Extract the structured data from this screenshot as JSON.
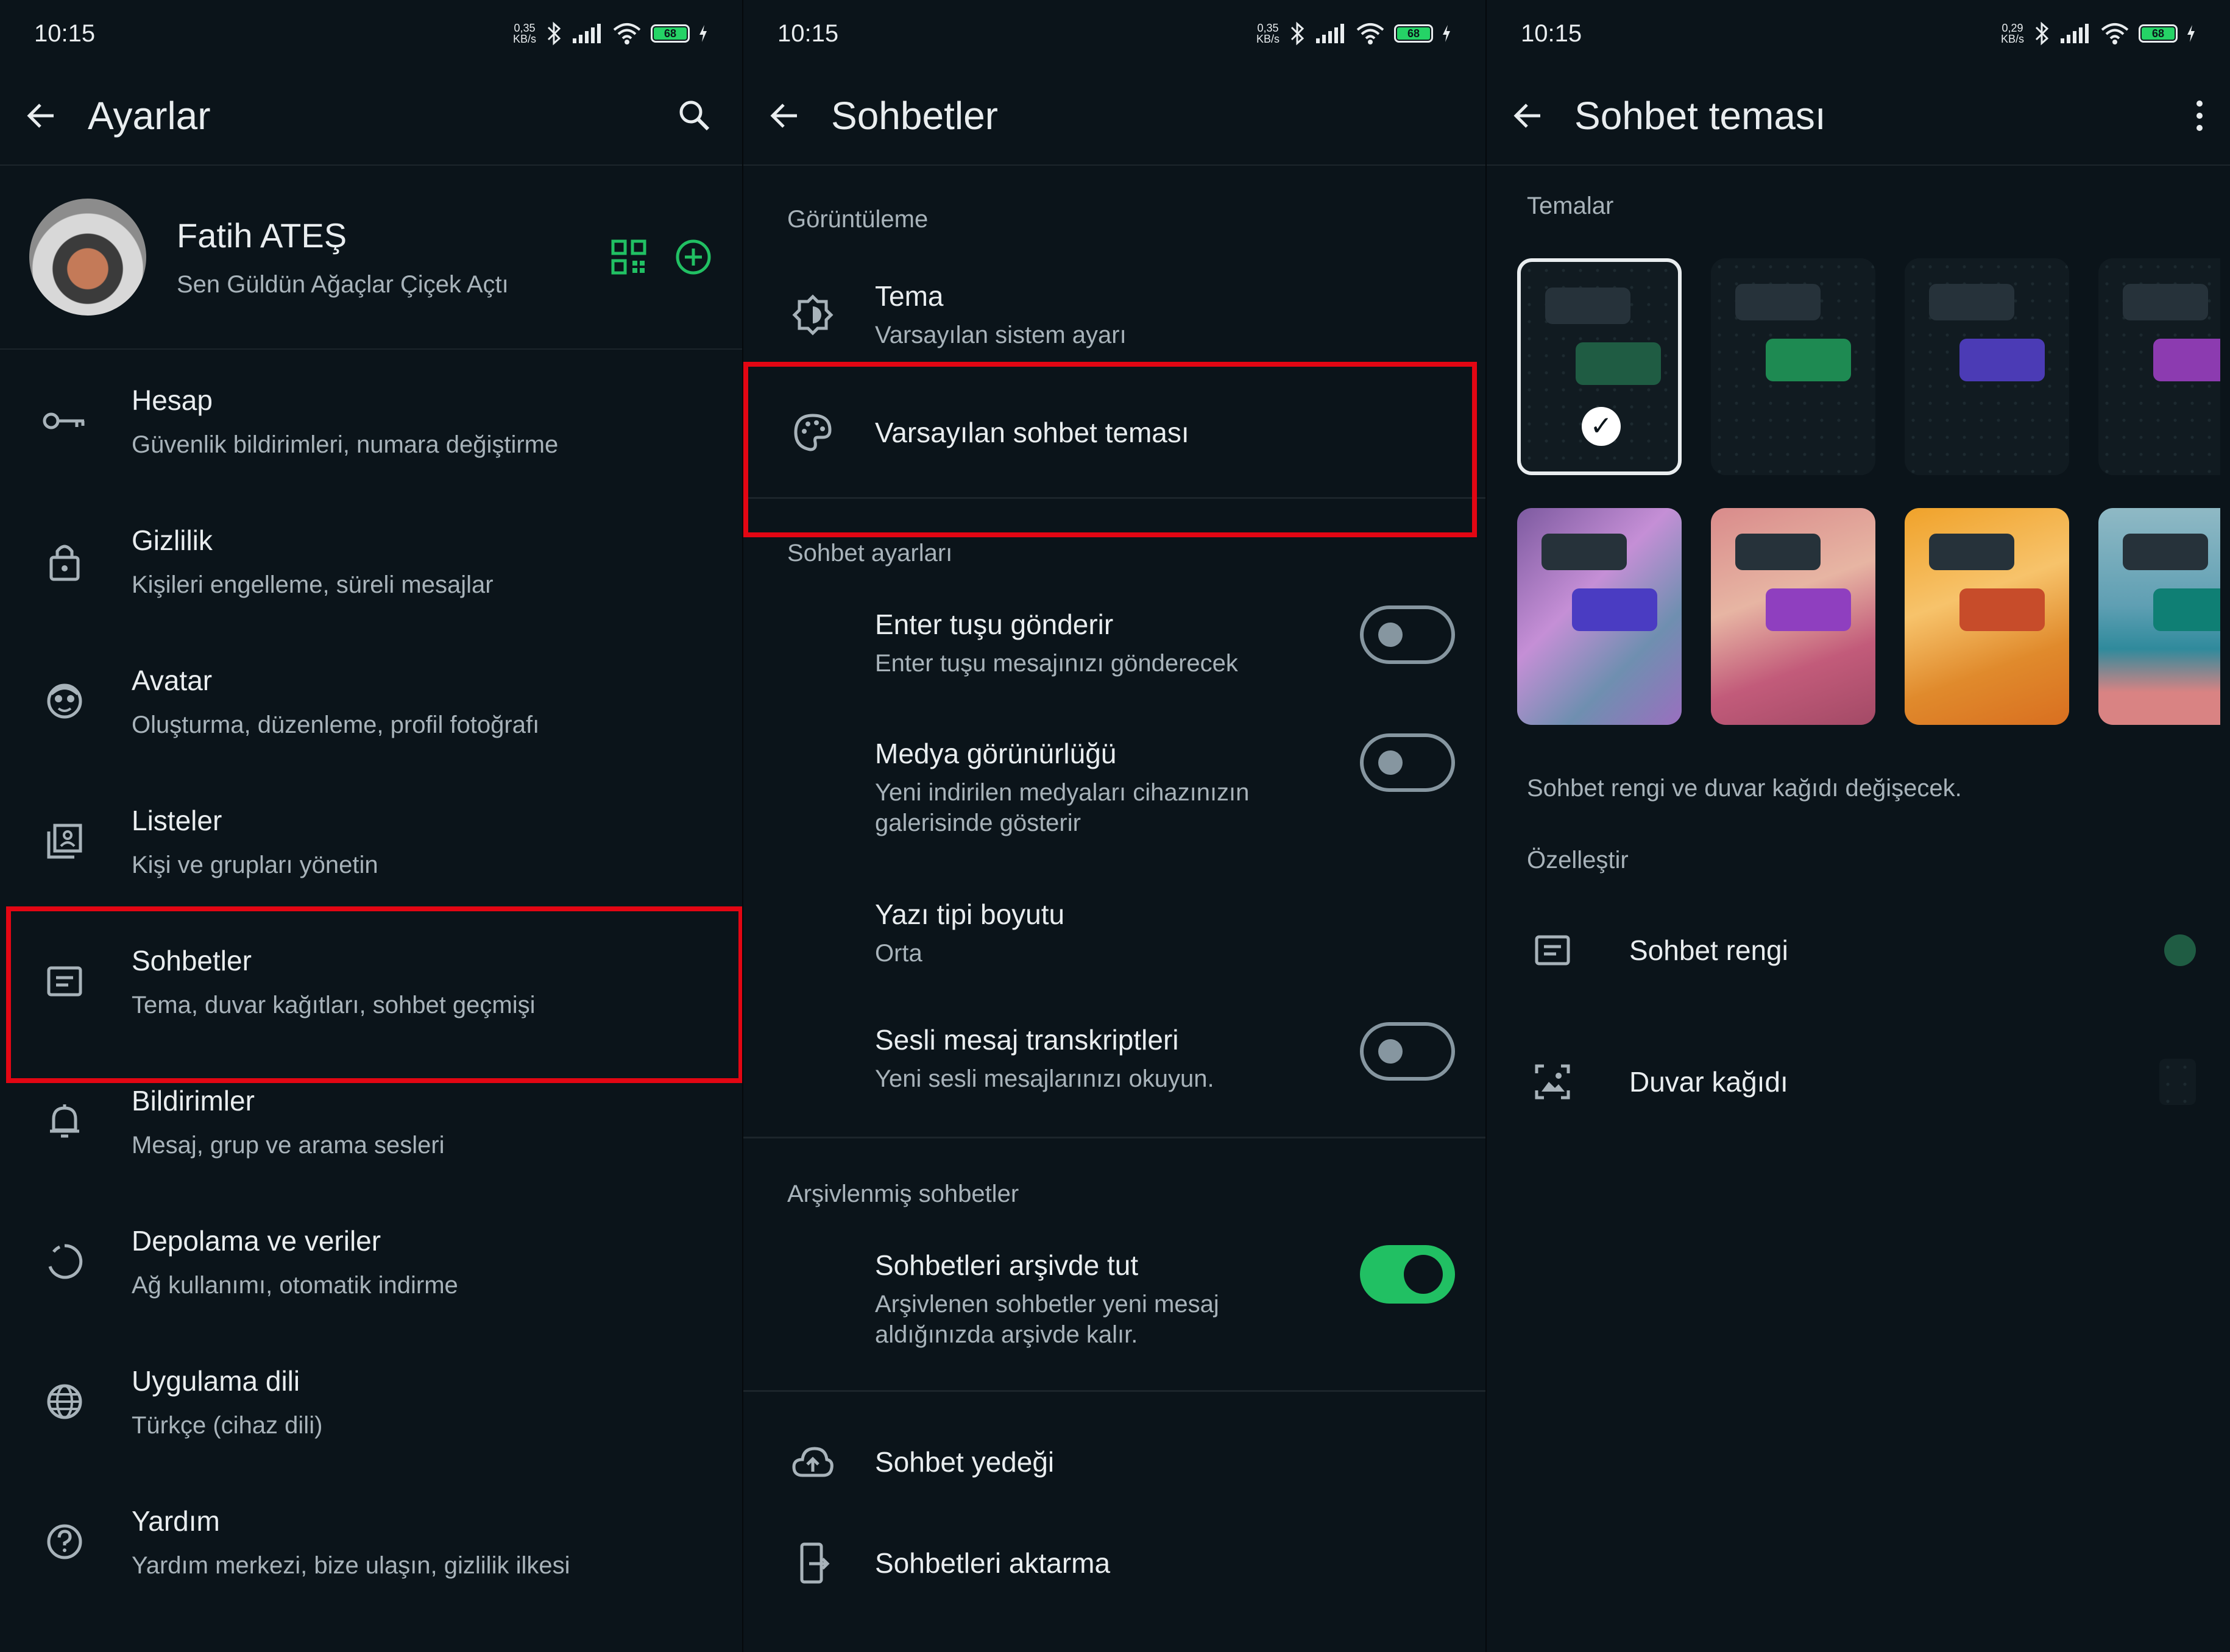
{
  "status": {
    "time": "10:15",
    "battery": "68"
  },
  "screen1": {
    "status_speed_top": "0,35",
    "status_speed_unit": "KB/s",
    "title": "Ayarlar",
    "profile": {
      "name": "Fatih ATEŞ",
      "about": "Sen Güldün Ağaçlar Çiçek Açtı"
    },
    "items": [
      {
        "title": "Hesap",
        "subtitle": "Güvenlik bildirimleri, numara değiştirme",
        "icon": "key-icon"
      },
      {
        "title": "Gizlilik",
        "subtitle": "Kişileri engelleme, süreli mesajlar",
        "icon": "lock-icon"
      },
      {
        "title": "Avatar",
        "subtitle": "Oluşturma, düzenleme, profil fotoğrafı",
        "icon": "avatar-icon"
      },
      {
        "title": "Listeler",
        "subtitle": "Kişi ve grupları yönetin",
        "icon": "lists-icon"
      },
      {
        "title": "Sohbetler",
        "subtitle": "Tema, duvar kağıtları, sohbet geçmişi",
        "icon": "chat-icon"
      },
      {
        "title": "Bildirimler",
        "subtitle": "Mesaj, grup ve arama sesleri",
        "icon": "bell-icon"
      },
      {
        "title": "Depolama ve veriler",
        "subtitle": "Ağ kullanımı, otomatik indirme",
        "icon": "storage-icon"
      },
      {
        "title": "Uygulama dili",
        "subtitle": "Türkçe (cihaz dili)",
        "icon": "globe-icon"
      },
      {
        "title": "Yardım",
        "subtitle": "Yardım merkezi, bize ulaşın, gizlilik ilkesi",
        "icon": "help-icon"
      }
    ]
  },
  "screen2": {
    "status_speed_top": "0,35",
    "status_speed_unit": "KB/s",
    "title": "Sohbetler",
    "section_display": "Görüntüleme",
    "theme": {
      "title": "Tema",
      "subtitle": "Varsayılan sistem ayarı"
    },
    "default_theme": {
      "title": "Varsayılan sohbet teması"
    },
    "section_chat_settings": "Sohbet ayarları",
    "enter_send": {
      "title": "Enter tuşu gönderir",
      "subtitle": "Enter tuşu mesajınızı gönderecek",
      "enabled": false
    },
    "media_visibility": {
      "title": "Medya görünürlüğü",
      "subtitle_line1": "Yeni indirilen medyaları cihazınızın",
      "subtitle_line2": "galerisinde gösterir",
      "enabled": false
    },
    "font_size": {
      "title": "Yazı tipi boyutu",
      "subtitle": "Orta"
    },
    "voice_transcripts": {
      "title": "Sesli mesaj transkriptleri",
      "subtitle": "Yeni sesli mesajlarınızı okuyun.",
      "enabled": false
    },
    "section_archived": "Arşivlenmiş sohbetler",
    "keep_archived": {
      "title": "Sohbetleri arşivde tut",
      "subtitle_line1": "Arşivlenen sohbetler yeni mesaj",
      "subtitle_line2": "aldığınızda arşivde kalır.",
      "enabled": true
    },
    "backup": {
      "title": "Sohbet yedeği"
    },
    "transfer": {
      "title": "Sohbetleri aktarma"
    }
  },
  "screen3": {
    "status_speed_top": "0,29",
    "status_speed_unit": "KB/s",
    "title": "Sohbet teması",
    "section_themes": "Temalar",
    "themes_row1": [
      {
        "bubble_color": "#1f5c43",
        "selected": true
      },
      {
        "bubble_color": "#1e8a52",
        "selected": false
      },
      {
        "bubble_color": "#4b3bb5",
        "selected": false
      },
      {
        "bubble_color": "#8c3bb0",
        "selected": false
      }
    ],
    "themes_row2": [
      {
        "bubble_color": "#4a3cc2",
        "bg": "purple"
      },
      {
        "bubble_color": "#8f3fbf",
        "bg": "pink"
      },
      {
        "bubble_color": "#c74c2a",
        "bg": "orange"
      },
      {
        "bubble_color": "#0f7f74",
        "bg": "sea"
      }
    ],
    "hint": "Sohbet rengi ve duvar kağıdı değişecek.",
    "section_customize": "Özelleştir",
    "chat_color": {
      "title": "Sohbet rengi",
      "value_color": "#1f5c43"
    },
    "wallpaper": {
      "title": "Duvar kağıdı"
    }
  },
  "colors": {
    "highlight": "#e30613",
    "accent": "#21c063",
    "background": "#0b141a"
  }
}
